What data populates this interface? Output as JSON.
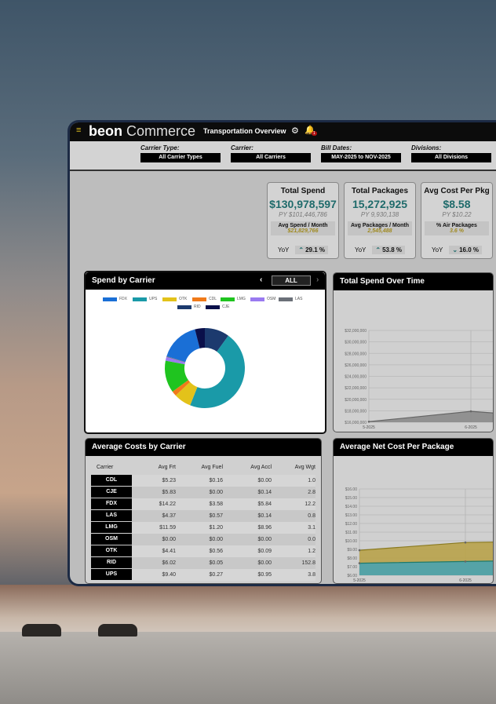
{
  "app": {
    "brand_bold": "beon",
    "brand_light": " Commerce",
    "page_title": "Transportation Overview",
    "notification_count": "1"
  },
  "filters": [
    {
      "label": "Carrier Type:",
      "value": "All Carrier Types"
    },
    {
      "label": "Carrier:",
      "value": "All Carriers"
    },
    {
      "label": "Bill Dates:",
      "value": "MAY-2025 to NOV-2025"
    },
    {
      "label": "Divisions:",
      "value": "All Divisions"
    }
  ],
  "kpis": [
    {
      "title": "Total Spend",
      "value": "$130,978,597",
      "py": "PY $101,446,786",
      "sub_label": "Avg Spend / Month",
      "sub_value": "$21,829,766",
      "yoy_label": "YoY",
      "yoy": "29.1 %",
      "yoy_dir": "up"
    },
    {
      "title": "Total Packages",
      "value": "15,272,925",
      "py": "PY 9,930,138",
      "sub_label": "Avg Packages / Month",
      "sub_value": "2,545,488",
      "yoy_label": "YoY",
      "yoy": "53.8 %",
      "yoy_dir": "up"
    },
    {
      "title": "Avg Cost Per Pkg",
      "value": "$8.58",
      "py": "PY $10.22",
      "sub_label": "% Air Packages",
      "sub_value": "3.6 %",
      "yoy_label": "YoY",
      "yoy": "16.0 %",
      "yoy_dir": "down"
    }
  ],
  "spend_by_carrier": {
    "title": "Spend by Carrier",
    "filter": "ALL"
  },
  "chart_data": [
    {
      "type": "pie",
      "title": "Spend by Carrier",
      "donut": true,
      "legend": "top",
      "slices": [
        {
          "name": "RID",
          "value": 10,
          "color": "#1c3a6e"
        },
        {
          "name": "UPS",
          "value": 46,
          "color": "#1a9aa8"
        },
        {
          "name": "OTK",
          "value": 7,
          "color": "#e3c21a"
        },
        {
          "name": "CDL",
          "value": 2,
          "color": "#f07a1a"
        },
        {
          "name": "LMG",
          "value": 13,
          "color": "#1fc41f"
        },
        {
          "name": "OSM",
          "value": 1.5,
          "color": "#9a7af0"
        },
        {
          "name": "LAS",
          "value": 0.3,
          "color": "#6b7078"
        },
        {
          "name": "FDX",
          "value": 16.2,
          "color": "#1a6fd6"
        },
        {
          "name": "CJE",
          "value": 4,
          "color": "#0a0f4a"
        }
      ],
      "legend_order": [
        "FDX",
        "UPS",
        "OTK",
        "CDL",
        "LMG",
        "OSM",
        "LAS",
        "RID",
        "CJE"
      ]
    },
    {
      "type": "area",
      "title": "Total Spend Over Time",
      "categories": [
        "5-2025",
        "6-2025"
      ],
      "values": [
        16100000,
        17900000
      ],
      "ylim": [
        16000000,
        32000000
      ],
      "yticks": [
        "$16,000,000",
        "$18,000,000",
        "$20,000,000",
        "$22,000,000",
        "$24,000,000",
        "$26,000,000",
        "$28,000,000",
        "$30,000,000",
        "$32,000,000"
      ],
      "grid": true,
      "color": "#8a8a8a"
    },
    {
      "type": "area",
      "title": "Average Net Cost Per Package",
      "categories": [
        "5-2025",
        "6-2025"
      ],
      "series": [
        {
          "values": [
            8.9,
            9.8
          ],
          "color": "#b8a24a"
        },
        {
          "values": [
            7.4,
            7.6
          ],
          "color": "#4aa3b0"
        }
      ],
      "ylim": [
        6,
        16
      ],
      "yticks": [
        "$6.00",
        "$7.00",
        "$8.00",
        "$9.00",
        "$10.00",
        "$11.00",
        "$12.00",
        "$13.00",
        "$14.00",
        "$15.00",
        "$16.00"
      ],
      "grid": true
    }
  ],
  "avg_costs": {
    "title": "Average Costs by Carrier",
    "headers": [
      "Carrier",
      "Avg Frt",
      "Avg Fuel",
      "Avg Accl",
      "Avg Wgt"
    ],
    "rows": [
      [
        "CDL",
        "$5.23",
        "$0.16",
        "$0.00",
        "1.0"
      ],
      [
        "CJE",
        "$5.83",
        "$0.00",
        "$0.14",
        "2.8"
      ],
      [
        "FDX",
        "$14.22",
        "$3.58",
        "$5.84",
        "12.2"
      ],
      [
        "LAS",
        "$4.37",
        "$0.57",
        "$0.14",
        "0.8"
      ],
      [
        "LMG",
        "$11.59",
        "$1.20",
        "$8.96",
        "3.1"
      ],
      [
        "OSM",
        "$0.00",
        "$0.00",
        "$0.00",
        "0.0"
      ],
      [
        "OTK",
        "$4.41",
        "$0.56",
        "$0.09",
        "1.2"
      ],
      [
        "RID",
        "$6.02",
        "$0.05",
        "$0.00",
        "152.8"
      ],
      [
        "UPS",
        "$9.40",
        "$0.27",
        "$0.95",
        "3.8"
      ]
    ]
  }
}
